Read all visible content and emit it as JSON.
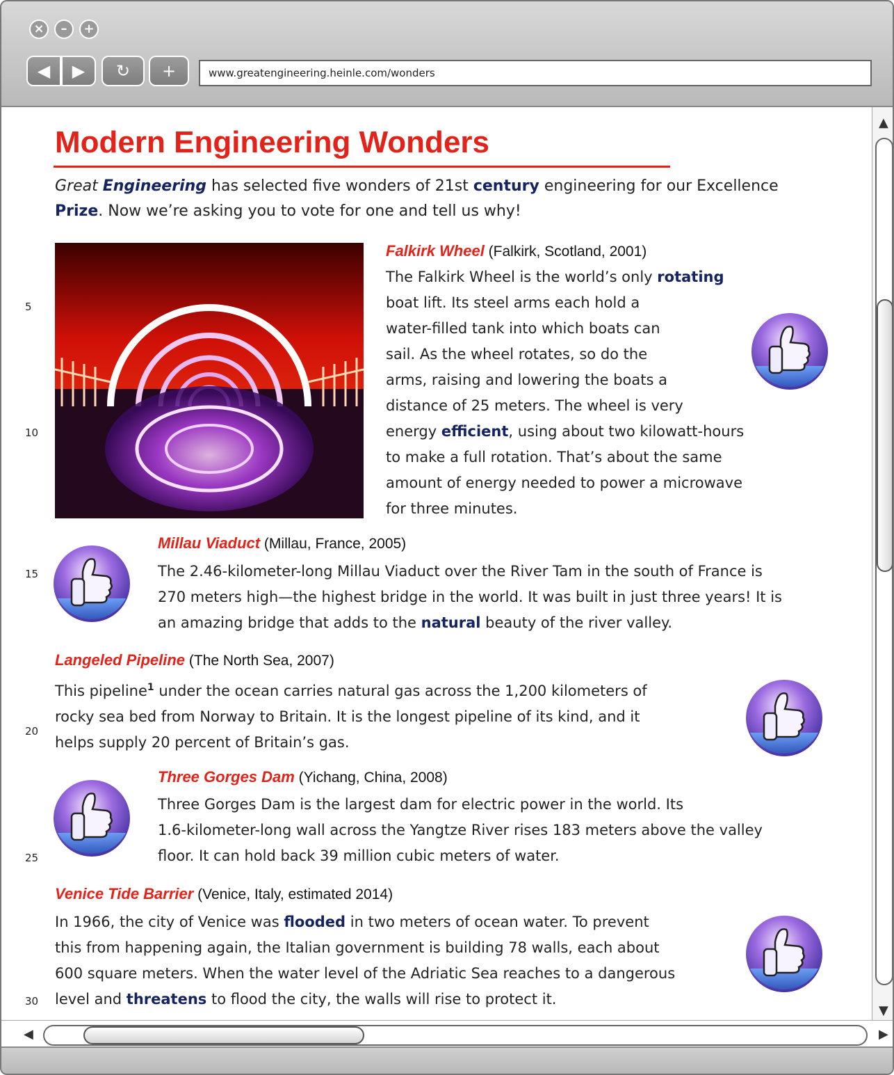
{
  "browser": {
    "url": "www.greatengineering.heinle.com/wonders",
    "window_buttons": [
      "close",
      "minimize",
      "zoom"
    ],
    "nav_buttons": [
      "back",
      "forward",
      "reload",
      "new-tab"
    ]
  },
  "page": {
    "title": "Modern Engineering Wonders",
    "intro": [
      {
        "t": "Great ",
        "s": "italic"
      },
      {
        "t": "Engineering",
        "s": "kwi"
      },
      {
        "t": " has selected five wonders of 21st ",
        "s": ""
      },
      {
        "t": "century",
        "s": "kw"
      },
      {
        "t": " engineering for our Excellence ",
        "s": ""
      },
      {
        "t": "Prize",
        "s": "kw"
      },
      {
        "t": ". Now we’re asking you to vote for one and tell us why!",
        "s": ""
      }
    ],
    "line_numbers": [
      "5",
      "10",
      "15",
      "20",
      "25",
      "30"
    ],
    "sections": [
      {
        "name": "Falkirk Wheel",
        "meta": " (Falkirk, Scotland, 2001)",
        "lines": [
          [
            {
              "t": "The Falkirk Wheel is the world’s only "
            },
            {
              "t": "rotating",
              "k": 1
            }
          ],
          [
            {
              "t": "boat lift. Its steel arms each hold a"
            }
          ],
          [
            {
              "t": "water-filled tank into which boats can"
            }
          ],
          [
            {
              "t": "sail. As the wheel rotates, so do the"
            }
          ],
          [
            {
              "t": "arms, raising and lowering the boats a"
            }
          ],
          [
            {
              "t": "distance of 25 meters. The wheel is very"
            }
          ],
          [
            {
              "t": "energy "
            },
            {
              "t": "efficient",
              "k": 1
            },
            {
              "t": ", using about two kilowatt-hours"
            }
          ],
          [
            {
              "t": "to make a full rotation. That’s about the same"
            }
          ],
          [
            {
              "t": "amount of energy needed to power a microwave"
            }
          ],
          [
            {
              "t": "for three minutes."
            }
          ]
        ]
      },
      {
        "name": "Millau Viaduct",
        "meta": " (Millau, France, 2005)",
        "lines": [
          [
            {
              "t": "The 2.46-kilometer-long Millau Viaduct over the River Tam in the south of France is"
            }
          ],
          [
            {
              "t": "270 meters high—the highest bridge in the world. It was built in just three years! It is"
            }
          ],
          [
            {
              "t": "an amazing bridge that adds to the "
            },
            {
              "t": "natural",
              "k": 1
            },
            {
              "t": " beauty of the river valley."
            }
          ]
        ]
      },
      {
        "name": "Langeled Pipeline",
        "meta": " (The North Sea, 2007)",
        "lines": [
          [
            {
              "t": "This pipeline"
            },
            {
              "t": "1",
              "sup": 1
            },
            {
              "t": " under the ocean carries natural gas across the 1,200 kilometers of"
            }
          ],
          [
            {
              "t": "rocky sea bed from Norway to Britain. It is the longest pipeline of its kind, and it"
            }
          ],
          [
            {
              "t": "helps supply 20 percent of Britain’s gas."
            }
          ]
        ]
      },
      {
        "name": "Three Gorges Dam",
        "meta": " (Yichang, China, 2008)",
        "lines": [
          [
            {
              "t": "Three Gorges Dam is the largest dam for electric power in the world. Its"
            }
          ],
          [
            {
              "t": "1.6-kilometer-long wall across the Yangtze River rises 183 meters above the valley"
            }
          ],
          [
            {
              "t": "floor. It can hold back 39 million cubic meters of water."
            }
          ]
        ]
      },
      {
        "name": "Venice Tide Barrier",
        "meta": " (Venice, Italy, estimated 2014)",
        "lines": [
          [
            {
              "t": "In 1966, the city of Venice was "
            },
            {
              "t": "flooded",
              "k": 1
            },
            {
              "t": " in two meters of ocean water. To prevent"
            }
          ],
          [
            {
              "t": "this from happening again, the Italian government is building 78 walls, each about"
            }
          ],
          [
            {
              "t": "600 square meters. When the water level of the Adriatic Sea reaches to a dangerous"
            }
          ],
          [
            {
              "t": "level and "
            },
            {
              "t": "threatens",
              "k": 1
            },
            {
              "t": " to flood the city, the walls will rise to protect it."
            }
          ]
        ]
      }
    ]
  },
  "icons": {
    "vote": "thumbs-up-icon",
    "photo": "falkirk-wheel-photo"
  },
  "colors": {
    "title_red": "#e2231a",
    "keyword_blue": "#152460"
  }
}
